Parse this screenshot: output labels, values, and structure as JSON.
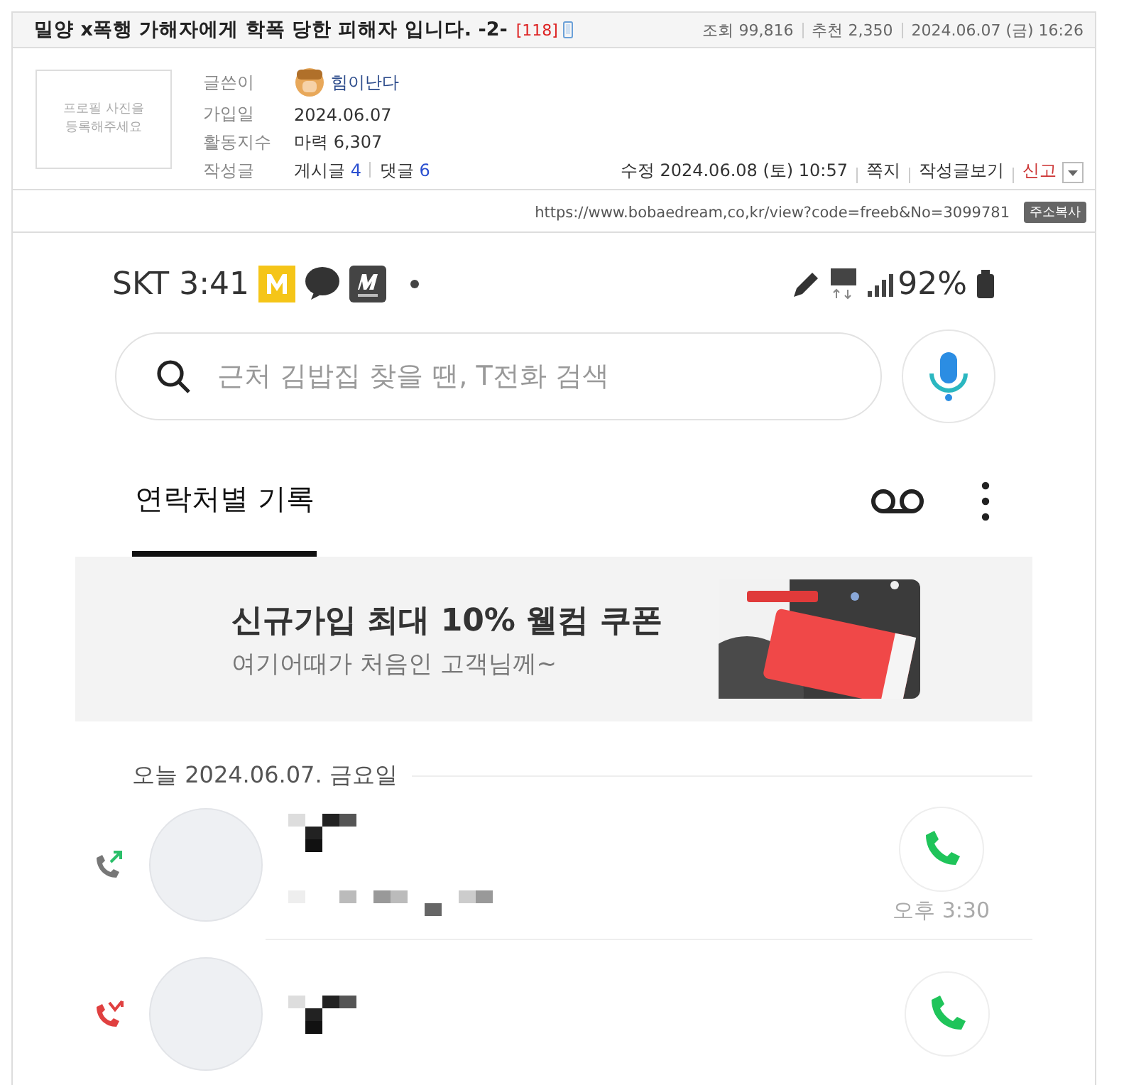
{
  "post": {
    "title": "밀양 x폭행 가해자에게 학폭 당한 피해자 입니다. -2-",
    "comment_count": "[118]",
    "stats": [
      {
        "label": "조회",
        "value": "99,816"
      },
      {
        "label": "추천",
        "value": "2,350"
      }
    ],
    "date": "2024.06.07 (금) 16:26"
  },
  "author": {
    "profile_placeholder": "프로필 사진을 등록해주세요",
    "fields": [
      {
        "label": "글쓴이",
        "kind": "nick",
        "value": "힘이난다"
      },
      {
        "label": "가입일",
        "kind": "text",
        "value": "2024.06.07"
      },
      {
        "label": "활동지수",
        "kind": "text",
        "value": "마력 6,307"
      },
      {
        "label": "작성글",
        "kind": "counts",
        "parts": [
          {
            "label": "게시글",
            "count": "4"
          },
          {
            "label": "댓글",
            "count": "6"
          }
        ]
      }
    ],
    "edited": "수정 2024.06.08 (토) 10:57",
    "links": [
      {
        "label": "쪽지",
        "kind": "normal"
      },
      {
        "label": "작성글보기",
        "kind": "normal"
      },
      {
        "label": "신고",
        "kind": "alert"
      }
    ]
  },
  "url": "https://www.bobaedream,co,kr/view?code=freeb&No=3099781",
  "copy_button": "주소복사",
  "phone": {
    "status_left": "SKT 3:41",
    "battery": "92%",
    "search_placeholder": "근처 김밥집 찾을 땐, T전화 검색",
    "tab": {
      "label": "연락처별 기록",
      "selected": true
    },
    "banner": {
      "title": "신규가입 최대 10% 웰컴 쿠폰",
      "subtitle": "여기어때가 처음인 고객님께~"
    },
    "date_header": "오늘 2024.06.07. 금요일",
    "calls": [
      {
        "kind": "outgoing",
        "time": "오후 3:30"
      },
      {
        "kind": "missed"
      }
    ]
  }
}
